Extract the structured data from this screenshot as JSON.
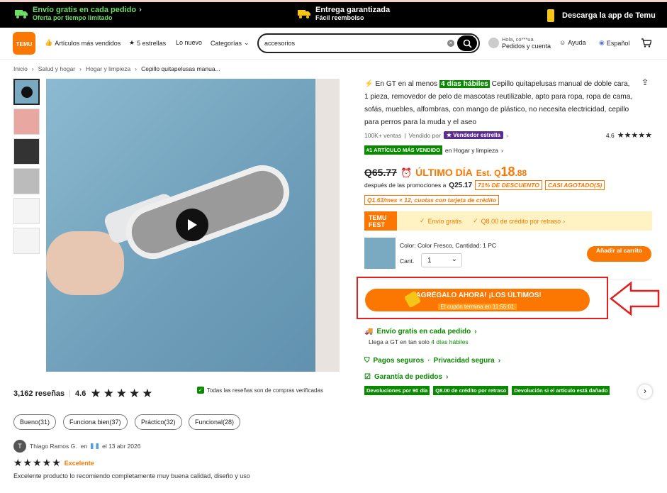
{
  "topbar": {
    "shipping_title": "Envío gratis en cada pedido",
    "shipping_sub": "Oferta por tiempo limitado",
    "delivery_title": "Entrega garantizada",
    "delivery_sub": "Fácil reembolso",
    "app": "Descarga la app de Temu"
  },
  "nav": {
    "logo": "TEMU",
    "bestsellers": "Artículos más vendidos",
    "five_stars": "5 estrellas",
    "new": "Lo nuevo",
    "categories": "Categorías",
    "search_value": "accesorios",
    "greeting": "Hola, co***ua",
    "orders": "Pedidos y cuenta",
    "help": "Ayuda",
    "language": "Español"
  },
  "breadcrumb": [
    "Inicio",
    "Salud y hogar",
    "Hogar y limpieza",
    "Cepillo quitapelusas manua..."
  ],
  "product": {
    "delivery_prefix": "En GT en al menos",
    "delivery_days": "4 días hábiles",
    "title": "Cepillo quitapelusas manual de doble cara, 1 pieza, removedor de pelo de mascotas reutilizable, apto para ropa, ropa de cama, sofás, muebles, alfombras, con mango de plástico, no necesita electricidad, cepillo para perros para la muda y el aseo",
    "sales": "100K+ ventas",
    "sold_by": "Vendido por",
    "vendor_badge": "Vendedor estrella",
    "rating": "4.6",
    "best_badge": "#1 ARTÍCULO MÁS VENDIDO",
    "best_cat": "en Hogar y limpieza",
    "orig_price": "Q65.77",
    "last_day": "ÚLTIMO DÍA",
    "est": "Est. Q",
    "price_int": "18",
    "price_dec": ".88",
    "after_promos": "después de las promociones a",
    "after_price": "Q25.17",
    "discount": "71% DE DESCUENTO",
    "almost_sold": "CASI AGOTADO(S)",
    "installments": "Q1.63/mes × 12, cuotas con tarjeta de crédito",
    "fest_logo": "TEMU FEST",
    "fest_ship": "Envío gratis",
    "fest_credit": "Q8.00 de crédito por retraso",
    "color_label": "Color: Color Fresco, Cantidad: 1 PC",
    "qty_label": "Cant.",
    "qty_value": "1",
    "add_cart": "Añadir al carrito",
    "cta": "¡AGRÉGALO AHORA! ¡LOS ÚLTIMOS!",
    "cta_timer": "El cupón termina en 11:55:01",
    "ship_title": "Envío gratis en cada pedido",
    "ship_sub_prefix": "Llega a GT en tan solo",
    "ship_sub_days": "4 días hábiles",
    "secure_pay": "Pagos seguros",
    "privacy": "Privacidad segura",
    "guarantee": "Garantía de pedidos",
    "g_badges": [
      "Devoluciones por 90 día",
      "Q8.00 de crédito por retraso",
      "Devolución si el artículo está dañado"
    ]
  },
  "reviews": {
    "count": "3,162 reseñas",
    "rating": "4.6",
    "verified": "Todas las reseñas son de compras verificadas",
    "tags": [
      "Bueno(31)",
      "Funciona bien(37)",
      "Práctico(32)",
      "Funcional(28)"
    ],
    "user_initial": "T",
    "user": "Thiago Ramos G.",
    "in": "en",
    "date": "el 13 abr 2026",
    "quality": "Excelente",
    "text": "Excelente producto lo recomiendo completamente muy buena calidad, diseño y uso"
  },
  "colors": {
    "accent": "#fb7701",
    "green": "#0a8a00",
    "highlight": "#e02020"
  }
}
